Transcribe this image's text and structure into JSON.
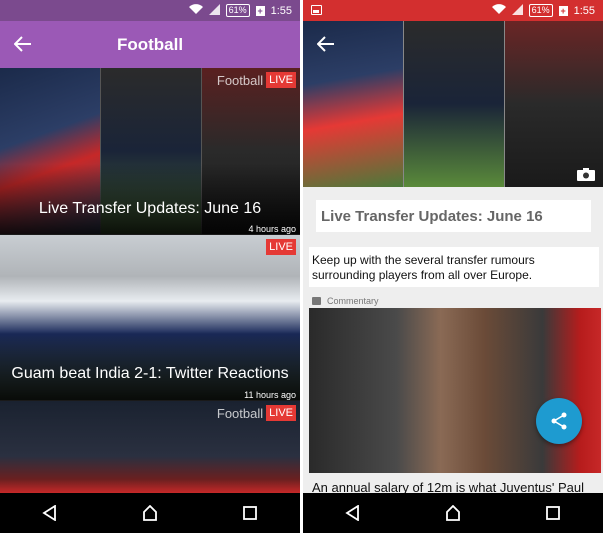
{
  "status_bar": {
    "battery": "61%",
    "time": "1:55"
  },
  "left_screen": {
    "toolbar": {
      "title": "Football"
    },
    "articles": [
      {
        "title": "Live Transfer Updates: June 16",
        "time": "4 hours ago",
        "badge_text": "Football",
        "badge_live": "LIVE"
      },
      {
        "title": "Guam beat India 2-1: Twitter Reactions",
        "time": "11 hours ago",
        "badge_text": "",
        "badge_live": "LIVE"
      },
      {
        "title": "",
        "time": "",
        "badge_text": "Football",
        "badge_live": "LIVE"
      }
    ]
  },
  "right_screen": {
    "article_title": "Live Transfer Updates: June 16",
    "description": "Keep up with the several transfer rumours surrounding players from all over Europe.",
    "commentary_label": "Commentary",
    "commentary_text": "An annual salary of 12m is what Juventus' Paul"
  },
  "colors": {
    "left_accent": "#9b59b6",
    "left_status": "#7b4a8e",
    "right_status": "#d32f2f",
    "live_badge": "#e53935",
    "fab": "#1e9bd0"
  }
}
